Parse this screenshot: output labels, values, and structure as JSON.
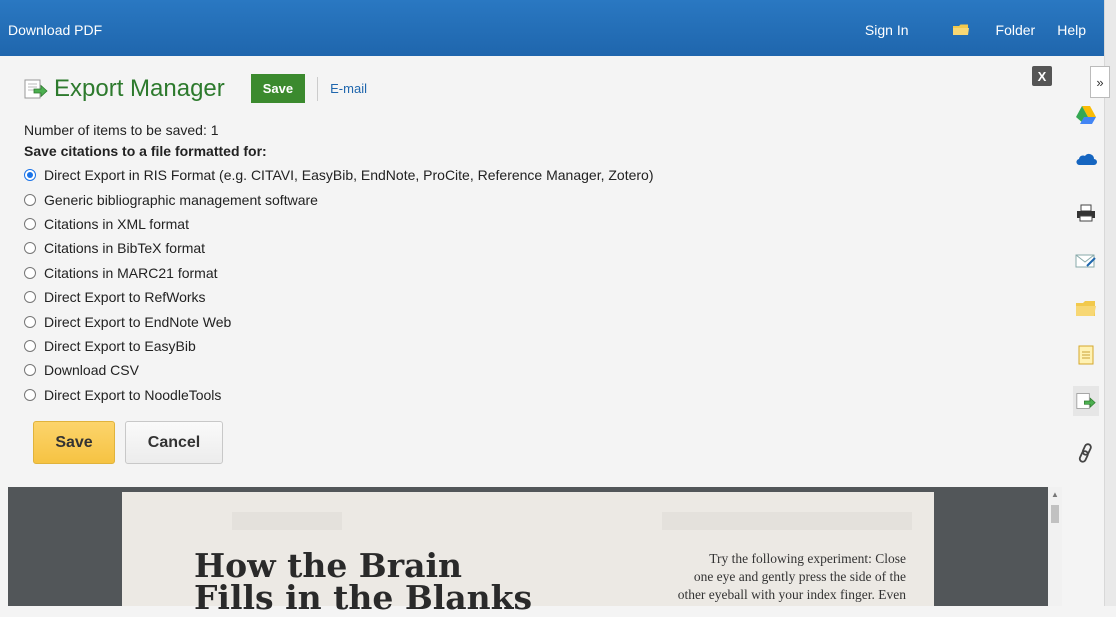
{
  "topbar": {
    "download_pdf": "Download PDF",
    "sign_in": "Sign In",
    "folder": "Folder",
    "help": "Help"
  },
  "export_manager": {
    "title": "Export Manager",
    "header_save": "Save",
    "header_email": "E-mail",
    "close": "X",
    "item_count_text": "Number of items to be saved: 1",
    "format_heading": "Save citations to a file formatted for:",
    "options": [
      {
        "label": "Direct Export in RIS Format (e.g. CITAVI, EasyBib, EndNote, ProCite, Reference Manager, Zotero)",
        "selected": true
      },
      {
        "label": "Generic bibliographic management software",
        "selected": false
      },
      {
        "label": "Citations in XML format",
        "selected": false
      },
      {
        "label": "Citations in BibTeX format",
        "selected": false
      },
      {
        "label": "Citations in MARC21 format",
        "selected": false
      },
      {
        "label": "Direct Export to RefWorks",
        "selected": false
      },
      {
        "label": "Direct Export to EndNote Web",
        "selected": false
      },
      {
        "label": "Direct Export to EasyBib",
        "selected": false
      },
      {
        "label": "Download CSV",
        "selected": false
      },
      {
        "label": "Direct Export to NoodleTools",
        "selected": false
      }
    ],
    "save_button": "Save",
    "cancel_button": "Cancel"
  },
  "tools": {
    "expand": "»",
    "items": [
      "google-drive-icon",
      "onedrive-icon",
      "print-icon",
      "email-icon",
      "folder-icon",
      "notes-icon",
      "export-icon",
      "permalink-icon"
    ]
  },
  "document": {
    "headline_line1": "How the Brain",
    "headline_line2": "Fills in the Blanks",
    "body_line1": "Try the following experiment: Close",
    "body_line2": "one eye and gently press the side of the",
    "body_line3": "other eyeball with your index finger. Even"
  },
  "colors": {
    "topbar": "#1f66ad",
    "title_green": "#2d7a2d",
    "save_green": "#3b8a2e",
    "save_yellow": "#f6c343",
    "link_blue": "#1f66ad",
    "viewer_bg": "#525659"
  }
}
